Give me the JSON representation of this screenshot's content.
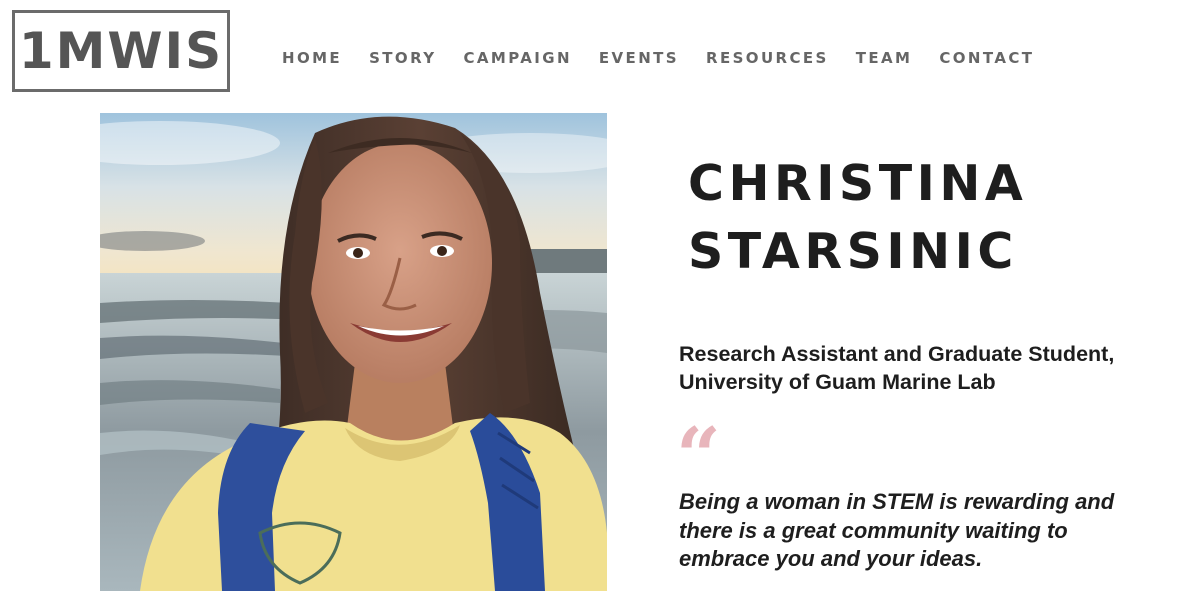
{
  "logo": {
    "text": "1MWIS"
  },
  "nav": {
    "items": [
      {
        "label": "HOME"
      },
      {
        "label": "STORY"
      },
      {
        "label": "CAMPAIGN"
      },
      {
        "label": "EVENTS"
      },
      {
        "label": "RESOURCES"
      },
      {
        "label": "TEAM"
      },
      {
        "label": "CONTACT"
      }
    ]
  },
  "profile": {
    "name_line1": "CHRISTINA",
    "name_line2": "STARSINIC",
    "role_line1": "Research Assistant and Graduate Student,",
    "role_line2": "University of Guam Marine Lab",
    "quote_mark": "“",
    "quote_line1": "Being a woman in STEM is rewarding and",
    "quote_line2": "there is a great community waiting to",
    "quote_line3": "embrace you and your ideas."
  },
  "colors": {
    "logo": "#555555",
    "nav_text": "#666666",
    "heading_text": "#1e1e1e",
    "quote_mark": "#e8b5bb"
  }
}
